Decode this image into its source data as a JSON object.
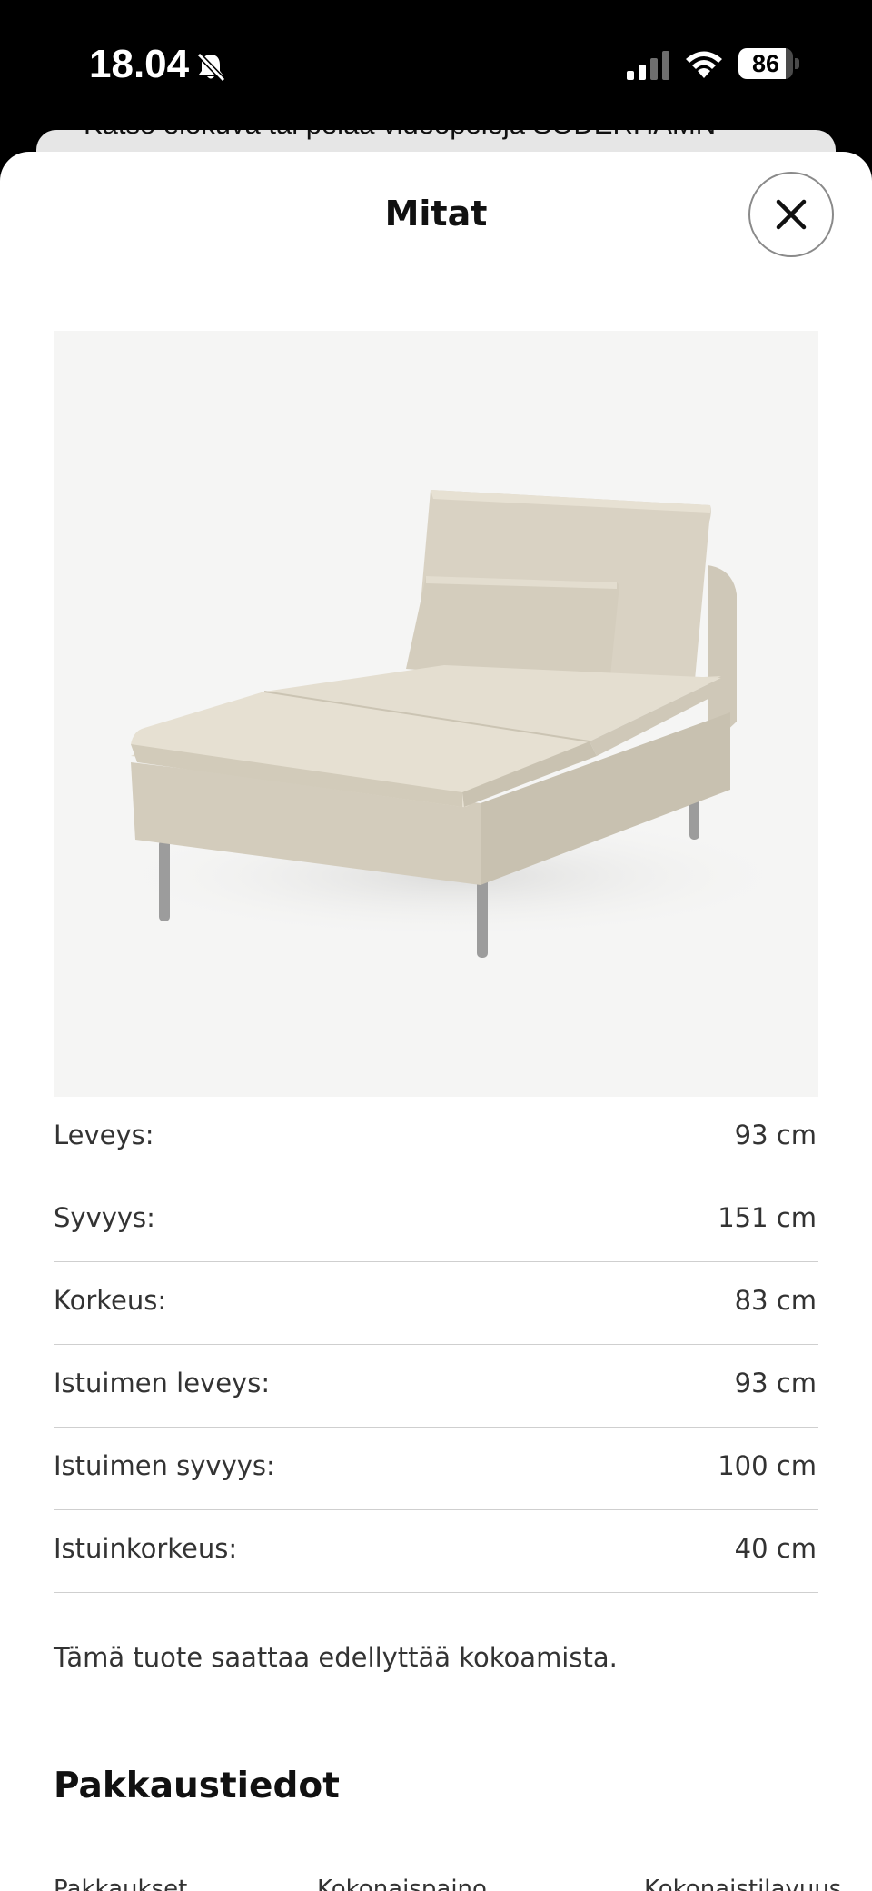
{
  "status_bar": {
    "time": "18.04",
    "battery": "86",
    "battery_level": 0.86
  },
  "background_sheet": {
    "text": "Katso elokuva tai pelaa videopelejä SÖDERHAMN"
  },
  "sheet": {
    "title": "Mitat",
    "close_icon": "close-icon",
    "image_alt": "SÖDERHAMN divaaniosa"
  },
  "dimensions": [
    {
      "label": "Leveys:",
      "value": "93 cm"
    },
    {
      "label": "Syvyys:",
      "value": "151 cm"
    },
    {
      "label": "Korkeus:",
      "value": "83 cm"
    },
    {
      "label": "Istuimen leveys:",
      "value": "93 cm"
    },
    {
      "label": "Istuimen syvyys:",
      "value": "100 cm"
    },
    {
      "label": "Istuinkorkeus:",
      "value": "40 cm"
    }
  ],
  "assembly_note": "Tämä tuote saattaa edellyttää kokoamista.",
  "packaging": {
    "title": "Pakkaustiedot",
    "column_headers": [
      "Pakkaukset",
      "Kokonaispaino",
      "Kokonaistilavuus"
    ]
  },
  "colors": {
    "sheet_bg": "#ffffff",
    "status_bg": "#000000",
    "divider": "#cfcfcf",
    "fabric": "#d8d1c2"
  }
}
